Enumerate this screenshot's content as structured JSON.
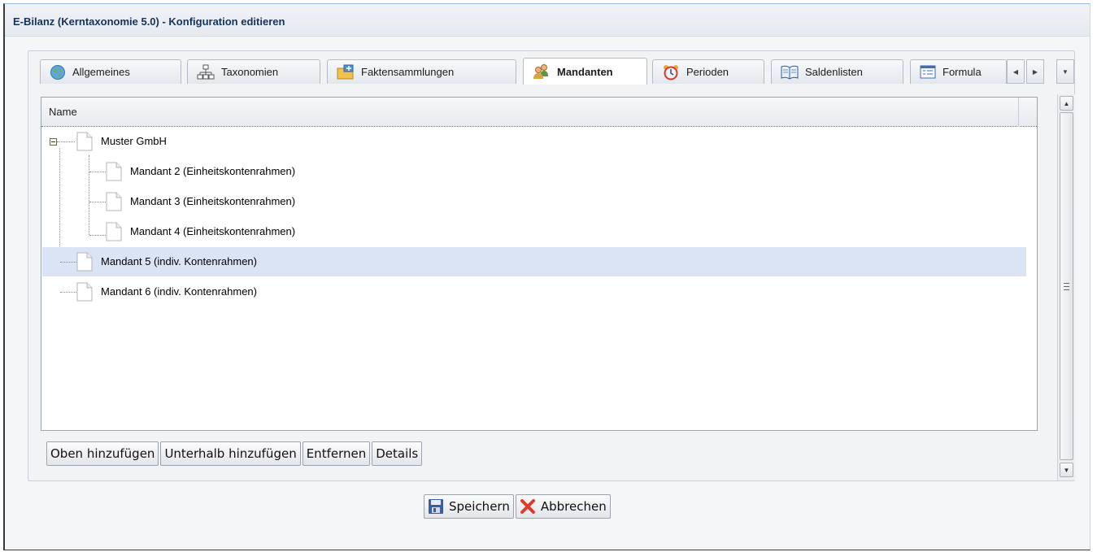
{
  "window": {
    "title": "E-Bilanz (Kerntaxonomie 5.0) - Konfiguration editieren"
  },
  "tabs": [
    {
      "label": "Allgemeines",
      "icon": "globe-icon",
      "active": false
    },
    {
      "label": "Taxonomien",
      "icon": "hierarchy-icon",
      "active": false
    },
    {
      "label": "Faktensammlungen",
      "icon": "folder-icon",
      "active": false
    },
    {
      "label": "Mandanten",
      "icon": "users-icon",
      "active": true
    },
    {
      "label": "Perioden",
      "icon": "alarm-clock-icon",
      "active": false
    },
    {
      "label": "Saldenlisten",
      "icon": "book-icon",
      "active": false
    },
    {
      "label": "Formula",
      "icon": "form-icon",
      "active": false
    }
  ],
  "tab_nav": {
    "scroll_left": "◀",
    "scroll_right": "▶",
    "menu": "▼"
  },
  "grid": {
    "column_header": "Name",
    "rows": [
      {
        "label": "Muster GmbH",
        "level": 0,
        "expanded": true,
        "selected": false
      },
      {
        "label": "Mandant 2 (Einheitskontenrahmen)",
        "level": 1,
        "selected": false
      },
      {
        "label": "Mandant 3 (Einheitskontenrahmen)",
        "level": 1,
        "selected": false
      },
      {
        "label": "Mandant 4 (Einheitskontenrahmen)",
        "level": 1,
        "selected": false
      },
      {
        "label": "Mandant 5 (indiv. Kontenrahmen)",
        "level": 0,
        "selected": true
      },
      {
        "label": "Mandant 6 (indiv. Kontenrahmen)",
        "level": 0,
        "selected": false
      }
    ]
  },
  "actions": {
    "add_above": "Oben hinzufügen",
    "add_below": "Unterhalb hinzufügen",
    "remove": "Entfernen",
    "details": "Details"
  },
  "scrollbar": {
    "up": "▲",
    "down": "▼"
  },
  "footer": {
    "save": "Speichern",
    "cancel": "Abbrechen"
  },
  "colors": {
    "selected_row": "#dbe4f4",
    "title_text": "#15325a",
    "cancel_icon": "#e03a2a",
    "save_icon": "#3b5f9e"
  }
}
